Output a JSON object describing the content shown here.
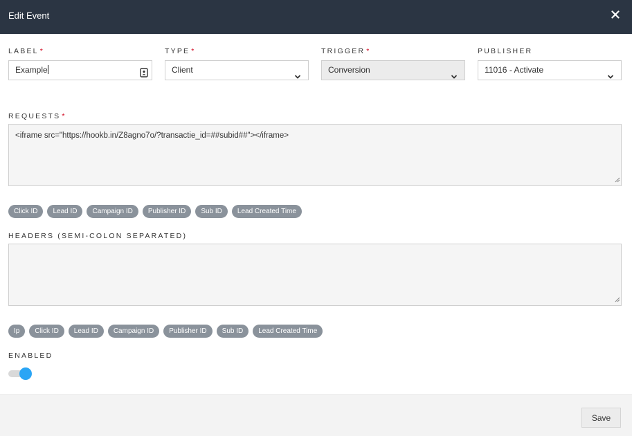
{
  "modal": {
    "title": "Edit Event",
    "close_icon": "close-icon"
  },
  "form": {
    "label": {
      "title": "LABEL",
      "required": "*",
      "value": "Example",
      "icon": "contact-book-icon"
    },
    "type": {
      "title": "TYPE",
      "required": "*",
      "value": "Client"
    },
    "trigger": {
      "title": "TRIGGER",
      "required": "*",
      "value": "Conversion"
    },
    "publisher": {
      "title": "PUBLISHER",
      "value": "11016 - Activate"
    },
    "requests": {
      "title": "REQUESTS",
      "required": "*",
      "value": "<iframe src=\"https://hookb.in/Z8agno7o/?transactie_id=##subid##\"></iframe>",
      "tokens": [
        "Click ID",
        "Lead ID",
        "Campaign ID",
        "Publisher ID",
        "Sub ID",
        "Lead Created Time"
      ]
    },
    "headers": {
      "title": "HEADERS (SEMI-COLON SEPARATED)",
      "value": "",
      "tokens": [
        "Ip",
        "Click ID",
        "Lead ID",
        "Campaign ID",
        "Publisher ID",
        "Sub ID",
        "Lead Created Time"
      ]
    },
    "enabled": {
      "title": "ENABLED",
      "state": true,
      "accent": "#2aa5f5"
    }
  },
  "footer": {
    "save_label": "Save"
  },
  "colors": {
    "header_bg": "#2b3543",
    "required": "#d0021b",
    "chip_bg": "#8a929b"
  }
}
